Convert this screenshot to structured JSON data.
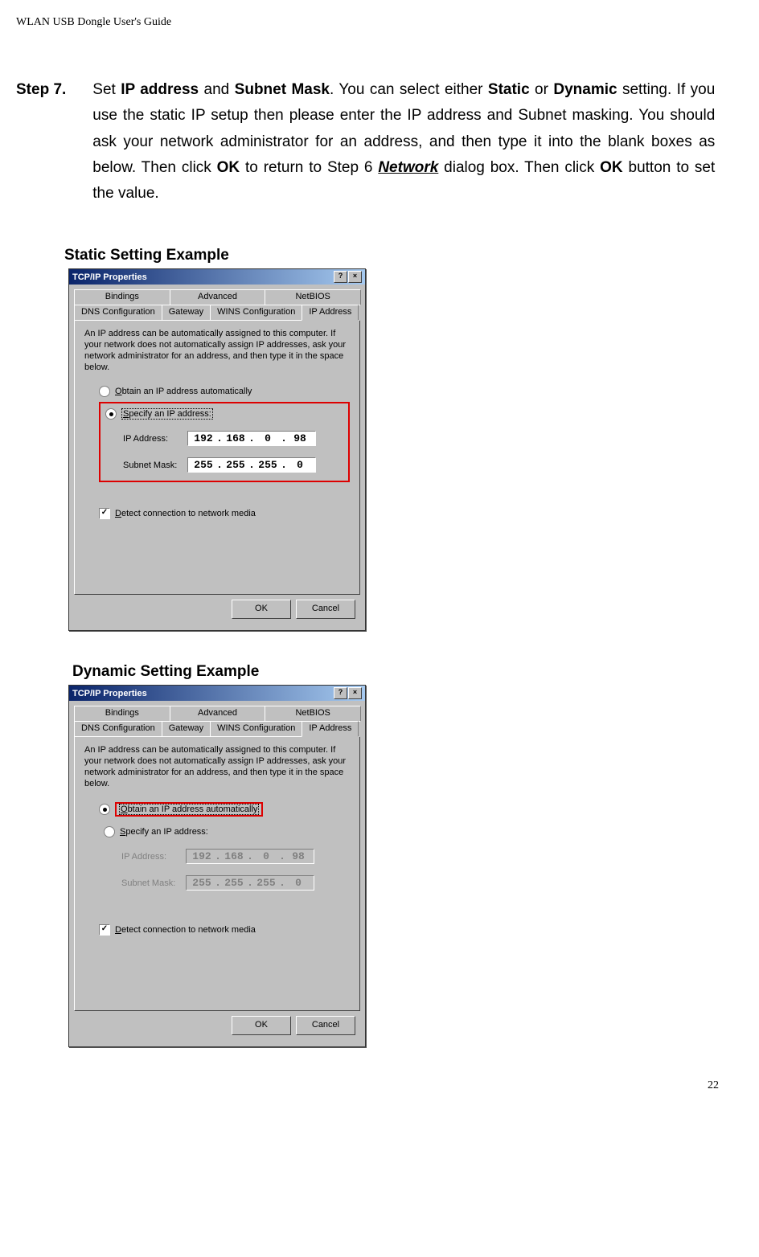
{
  "header": "WLAN USB Dongle User's Guide",
  "step": {
    "label": "Step 7.",
    "pre": "Set ",
    "b1": "IP address",
    "mid1": " and ",
    "b2": "Subnet Mask",
    "mid2": ". You can select either ",
    "b3": "Static",
    "mid3": " or ",
    "b4": "Dynamic",
    "mid4": " setting. If you use the static IP setup then please enter the IP address and Subnet masking. You should ask your network administrator for an address, and then type it into the blank boxes as below. Then click ",
    "b5": "OK",
    "mid5": " to return to Step 6 ",
    "b6": "Network",
    "mid6": " dialog box. Then click ",
    "b7": "OK",
    "tail": " button to set the value."
  },
  "titles": {
    "static": "Static Setting Example",
    "dynamic": "Dynamic Setting Example"
  },
  "dialog": {
    "title": "TCP/IP Properties",
    "help_btn": "?",
    "close_btn": "×",
    "tabs_row1": [
      "Bindings",
      "Advanced",
      "NetBIOS"
    ],
    "tabs_row2": [
      "DNS Configuration",
      "Gateway",
      "WINS Configuration",
      "IP Address"
    ],
    "help_text": "An IP address can be automatically assigned to this computer. If your network does not automatically assign IP addresses, ask your network administrator for an address, and then type it in the space below.",
    "radio_obtain_pre": "O",
    "radio_obtain": "btain an IP address automatically",
    "radio_specify_pre": "S",
    "radio_specify": "pecify an IP address:",
    "ip_label_pre": "I",
    "ip_label": "P Address:",
    "subnet_label": "S",
    "subnet_label_u": "u",
    "subnet_label_post": "bnet Mask:",
    "ip": [
      "192",
      "168",
      "0",
      "98"
    ],
    "subnet": [
      "255",
      "255",
      "255",
      "0"
    ],
    "detect_pre": "D",
    "detect": "etect connection to network media",
    "ok": "OK",
    "cancel": "Cancel"
  },
  "page_number": "22"
}
